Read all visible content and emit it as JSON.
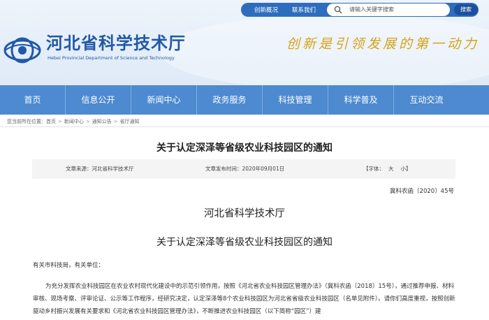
{
  "topbar": {
    "links": [
      "创新概况",
      "联系我们"
    ],
    "search_placeholder": "请输入关键字搜索",
    "search_button": "搜索"
  },
  "header": {
    "site_title": "河北省科学技术厅",
    "site_subtitle": "Hebei Provincial Department of Science and Technology",
    "slogan": "创新是引领发展的第一动力",
    "brand_color": "#2158a8",
    "slogan_color": "#d6a317"
  },
  "nav": {
    "color": "#4d8ad0",
    "items": [
      "首页",
      "信息公开",
      "新闻中心",
      "政务服务",
      "科技管理",
      "科学普及",
      "互动交流"
    ]
  },
  "breadcrumb": {
    "prefix": "您当前所在位置：",
    "items": [
      "首页",
      "新闻中心",
      "通知公告",
      "省厅通知"
    ]
  },
  "article": {
    "title": "关于认定深泽等省级农业科技园区的通知",
    "source": "文章来源：河北省科学技术厅",
    "date": "文章发布时间：2020年09月01日",
    "font_label": "【字体：",
    "font_large": "大",
    "font_small": "小",
    "font_close": "】",
    "doc_number": "冀科农函〔2020〕45号",
    "org": "河北省科学技术厅",
    "notice_title": "关于认定深泽等省级农业科技园区的通知",
    "greeting": "有关市科技局，有关单位：",
    "body": "为充分发挥农业科技园区在农业农村现代化建设中的示范引领作用，按照《河北省农业科技园区管理办法》（冀科农函〔2018〕15号），通过推荐申报、材料审核、现场考察、评审论证、公示等工作程序，经研究决定，认定深泽等8个农业科技园区为河北省省级农业科技园区（名单见附件）。请你们高度重视，按照创新驱动乡村振兴发展有关要求和《河北省农业科技园区管理办法》，不断推进农业科技园区（以下简称“园区”）建"
  }
}
